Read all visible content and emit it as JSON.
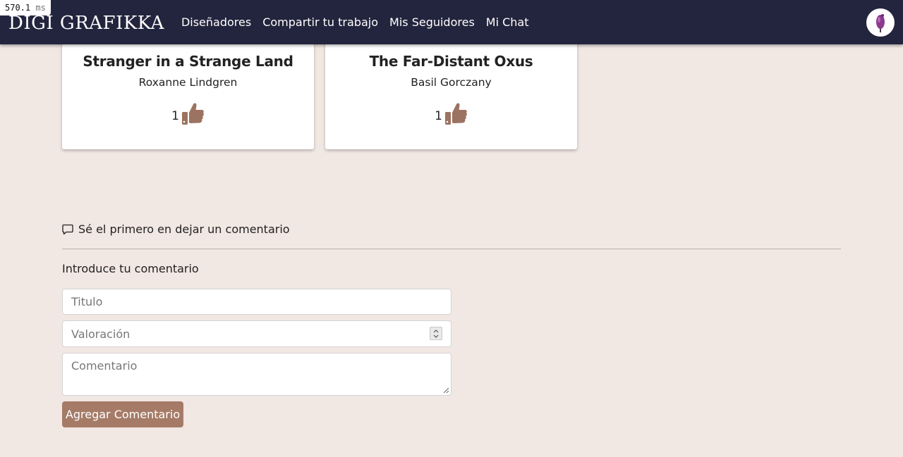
{
  "timing": {
    "value": "570.1",
    "unit": "ms"
  },
  "navbar": {
    "brand": "DIGI GRAFIKKA",
    "links": [
      "Diseñadores",
      "Compartir tu trabajo",
      "Mis Seguidores",
      "Mi Chat"
    ],
    "avatar_icon": "user-avatar-icon"
  },
  "cards": [
    {
      "title": "Stranger in a Strange Land",
      "author": "Roxanne Lindgren",
      "likes": "1",
      "icon": "thumbs-up-icon"
    },
    {
      "title": "The Far-Distant Oxus",
      "author": "Basil Gorczany",
      "likes": "1",
      "icon": "thumbs-up-icon"
    }
  ],
  "comments": {
    "notice_icon": "chat-bubble-icon",
    "notice": "Sé el primero en dejar un comentario",
    "form_label": "Introduce tu comentario",
    "title_placeholder": "Titulo",
    "rating_placeholder": "Valoración",
    "comment_placeholder": "Comentario",
    "submit_label": "Agregar Comentario"
  },
  "colors": {
    "navbar": "#23243d",
    "background": "#f1e7e3",
    "accent": "#a57b67"
  }
}
